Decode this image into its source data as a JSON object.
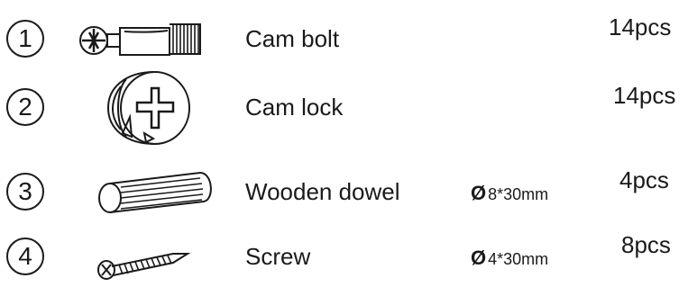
{
  "items": [
    {
      "num": "1",
      "name": "Cam bolt",
      "spec": "",
      "qty": "14pcs",
      "icon": "cam-bolt-icon"
    },
    {
      "num": "2",
      "name": "Cam lock",
      "spec": "",
      "qty": "14pcs",
      "icon": "cam-lock-icon"
    },
    {
      "num": "3",
      "name": "Wooden dowel",
      "spec_symbol": "Ø",
      "spec": "8*30mm",
      "qty": "4pcs",
      "icon": "wooden-dowel-icon"
    },
    {
      "num": "4",
      "name": "Screw",
      "spec_symbol": "Ø",
      "spec": "4*30mm",
      "qty": "8pcs",
      "icon": "screw-icon"
    }
  ]
}
